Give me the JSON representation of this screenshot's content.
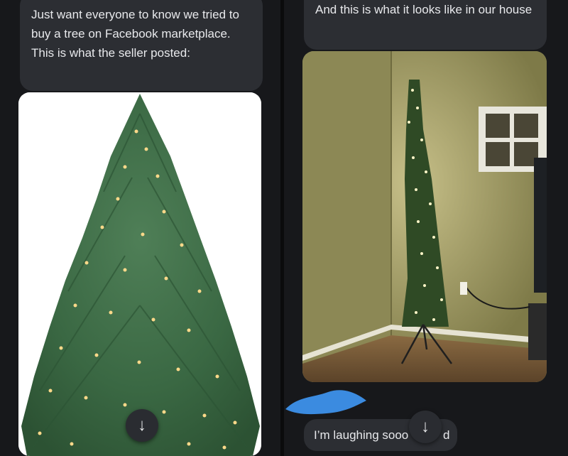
{
  "conversation": {
    "left": {
      "message_text": "Just want everyone to know we tried to buy a tree on Facebook marketplace. This is what the seller posted:",
      "photo_subject": "christmas-tree-listing-photo"
    },
    "right": {
      "message_text": "And this is what it looks like in our house",
      "photo_subject": "skinny-tree-in-corner-photo",
      "reply_text": "I’m laughing sooo",
      "reply_tail": "d"
    }
  },
  "controls": {
    "scroll_icon": "arrow-down-icon",
    "scroll_glyph": "↓"
  },
  "colors": {
    "background": "#17181b",
    "bubble": "#2c2e33",
    "text": "#e8e9ec",
    "redaction": "#3b8be0"
  }
}
